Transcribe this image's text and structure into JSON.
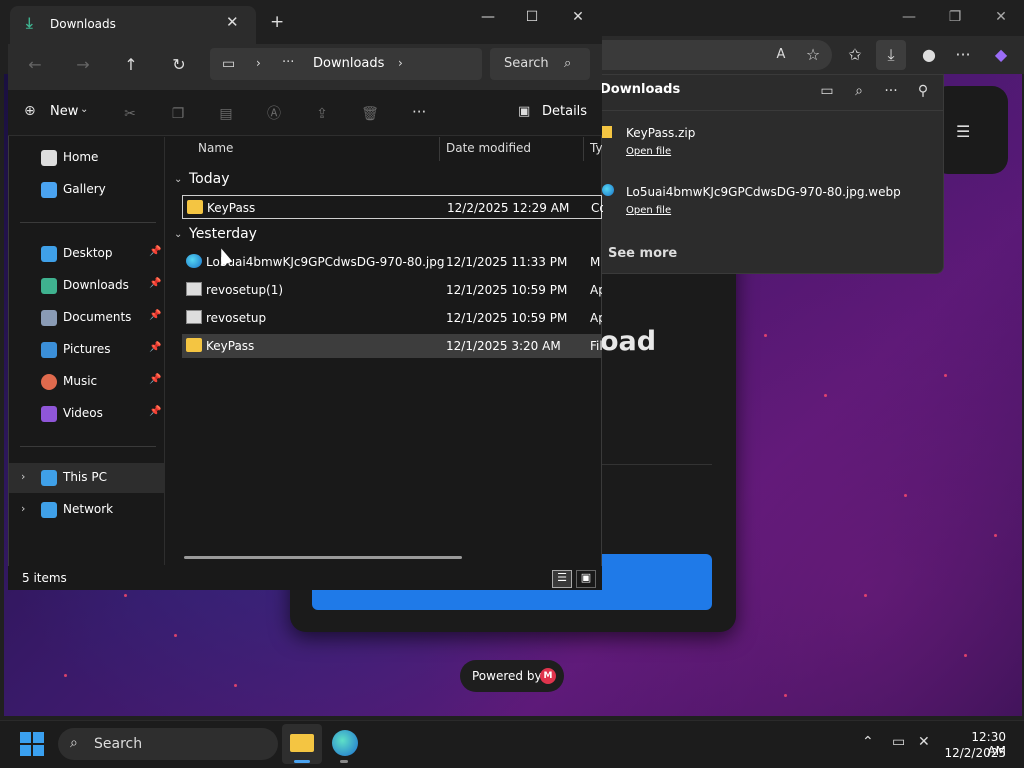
{
  "browser": {
    "window_controls": {
      "minimize": "—",
      "restore": "❐",
      "close": "✕"
    },
    "toolbar_icons": [
      "read-aloud-icon",
      "favorite-icon",
      "favorites-list-icon",
      "downloads-icon",
      "profile-icon",
      "more-icon",
      "copilot-icon"
    ],
    "page": {
      "heading_fragment": "oad",
      "powered_by": "Powered by",
      "powered_logo": "M"
    }
  },
  "downloads_panel": {
    "title": "Downloads",
    "icons": [
      "open-folder-icon",
      "search-icon",
      "more-icon",
      "pin-icon"
    ],
    "items": [
      {
        "name": "KeyPass.zip",
        "action": "Open file",
        "icon": "zip-folder-icon"
      },
      {
        "name": "Lo5uai4bmwKJc9GPCdwsDG-970-80.jpg.webp",
        "action": "Open file",
        "icon": "edge-file-icon"
      }
    ],
    "see_more": "See more"
  },
  "explorer": {
    "tab_title": "Downloads",
    "new_tab": "+",
    "window_controls": {
      "minimize": "—",
      "maximize": "☐",
      "close": "✕"
    },
    "nav": {
      "back": "←",
      "forward": "→",
      "up": "↑",
      "refresh": "↻"
    },
    "breadcrumb": {
      "overflow": "···",
      "current": "Downloads"
    },
    "search_placeholder": "Search",
    "command_bar": {
      "new_label": "New",
      "more": "···",
      "details_label": "Details"
    },
    "sidebar": {
      "quick": [
        {
          "label": "Home",
          "color": "#f0f0f0"
        },
        {
          "label": "Gallery",
          "color": "#4aa3f0"
        }
      ],
      "pinned": [
        {
          "label": "Desktop",
          "color": "#3fa0e8"
        },
        {
          "label": "Downloads",
          "color": "#3fb28f"
        },
        {
          "label": "Documents",
          "color": "#8a9bb5"
        },
        {
          "label": "Pictures",
          "color": "#3b8fd8"
        },
        {
          "label": "Music",
          "color": "#e06a4d"
        },
        {
          "label": "Videos",
          "color": "#8f56d8"
        }
      ],
      "tree": [
        {
          "label": "This PC",
          "color": "#3fa0e8"
        },
        {
          "label": "Network",
          "color": "#3fa0e8"
        }
      ]
    },
    "columns": {
      "name": "Name",
      "date": "Date modified",
      "type": "Ty"
    },
    "groups": [
      {
        "label": "Today",
        "files": [
          {
            "name": "KeyPass",
            "date": "12/2/2025 12:29 AM",
            "type": "Co",
            "icon": "zip-folder"
          }
        ]
      },
      {
        "label": "Yesterday",
        "files": [
          {
            "name": "Lo5uai4bmwKJc9GPCdwsDG-970-80.jpg",
            "date": "12/1/2025 11:33 PM",
            "type": "M",
            "icon": "edge"
          },
          {
            "name": "revosetup(1)",
            "date": "12/1/2025 10:59 PM",
            "type": "Ap",
            "icon": "setup"
          },
          {
            "name": "revosetup",
            "date": "12/1/2025 10:59 PM",
            "type": "Ap",
            "icon": "setup"
          },
          {
            "name": "KeyPass",
            "date": "12/1/2025 3:20 AM",
            "type": "Fil",
            "icon": "folder"
          }
        ]
      }
    ],
    "status": "5 items"
  },
  "taskbar": {
    "search_label": "Search",
    "time": "12:30 AM",
    "date": "12/2/2025"
  }
}
